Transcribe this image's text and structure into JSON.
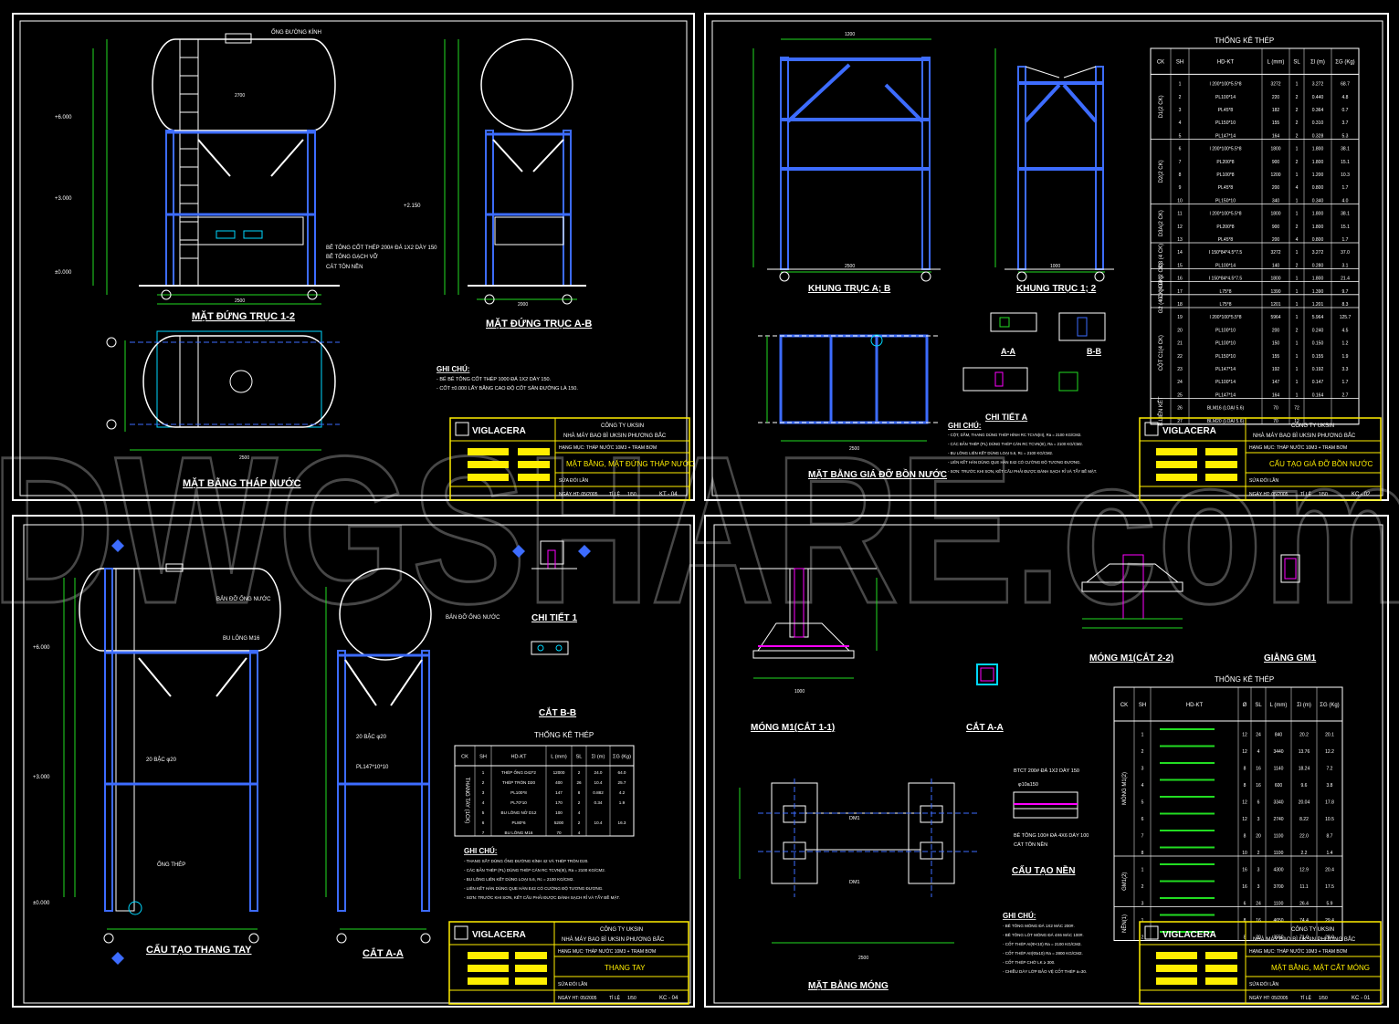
{
  "watermark": "DWGSHARE.com",
  "colors": {
    "struct": "#3d6cff",
    "dim": "#22dd22",
    "line": "#ffffff",
    "accent": "#ff00ff",
    "cyan": "#00d8ff",
    "yellow": "#ffee00"
  },
  "company": {
    "logo": "VIGLACERA",
    "name": "CÔNG TY UKSIN",
    "project": "NHÀ MÁY BAO BÌ UKSIN PHƯƠNG BẮC",
    "item": "HẠNG MỤC: THÁP NƯỚC 10M3 + TRẠM BƠM",
    "date": "NGÀY HT: 05/2005",
    "scale": "TỈ LỆ",
    "scale_val": "1/50",
    "draw": "THỰC",
    "rev": "SỬA ĐỔI LẦN",
    "shbv": "SH.B.V"
  },
  "sheet1": {
    "views": [
      "MẶT ĐỨNG TRỤC 1-2",
      "MẶT ĐỨNG TRỤC A-B",
      "MẶT BẰNG THÁP NƯỚC"
    ],
    "levels": [
      "+6.000",
      "+3.000",
      "+2.150",
      "±0.000"
    ],
    "notes_title": "GHI CHÚ:",
    "notes": [
      "- BỂ BÊ TÔNG CỐT THÉP 1000 ĐÁ 1X2 DÀY 150.",
      "- CỐT ±0.000 LẤY BẰNG CAO ĐỘ CỐT SÂN ĐƯỜNG LÀ 150."
    ],
    "labels": [
      "ỐNG ĐƯỜNG KÍNH",
      "BÊ TÔNG CỐT THÉP 200# ĐÁ 1X2 DÀY 150",
      "BÊ TÔNG GẠCH VỠ",
      "CÁT TÔN NỀN"
    ],
    "title_block": "MẶT BẰNG, MẶT ĐỨNG THÁP NƯỚC",
    "code": "KT - 04",
    "dims": [
      "2700",
      "2500",
      "900",
      "2000"
    ]
  },
  "sheet2": {
    "views": [
      "KHUNG TRỤC A; B",
      "KHUNG TRỤC 1; 2",
      "MẶT BẰNG GIÁ ĐỠ BỒN NƯỚC",
      "A-A",
      "B-B",
      "CHI TIẾT A"
    ],
    "table_title": "THỐNG KÊ THÉP",
    "table_headers": [
      "CK",
      "SH",
      "HD-KT",
      "L (mm)",
      "SL",
      "Σl (m)",
      "ΣG (Kg)"
    ],
    "groups": [
      "D1(2 CK)",
      "D2(2 CK)",
      "D3A(2 CK)",
      "D3 (4 CK)",
      "D4 (2 CK)",
      "G1 (4 CK)",
      "G2 (4 CK)",
      "CỘT C1(4 CK)",
      "B.LIÊN KẾT"
    ],
    "rows": [
      [
        "1",
        "I 200*100*5.5*8",
        "3272",
        "1",
        "3.272",
        "68.7"
      ],
      [
        "2",
        "PL100*14",
        "220",
        "2",
        "0.440",
        "4.8"
      ],
      [
        "3",
        "PL45*8",
        "182",
        "2",
        "0.364",
        "0.7"
      ],
      [
        "4",
        "PL150*10",
        "155",
        "2",
        "0.310",
        "3.7"
      ],
      [
        "5",
        "PL147*14",
        "164",
        "2",
        "0.328",
        "5.3"
      ],
      [
        "6",
        "I 200*100*5.5*8",
        "1800",
        "1",
        "1.800",
        "38.1"
      ],
      [
        "7",
        "PL200*8",
        "900",
        "2",
        "1.800",
        "15.1"
      ],
      [
        "8",
        "PL100*8",
        "1200",
        "1",
        "1.200",
        "10.3"
      ],
      [
        "9",
        "PL45*8",
        "200",
        "4",
        "0.800",
        "1.7"
      ],
      [
        "10",
        "PL150*10",
        "340",
        "1",
        "0.340",
        "4.0"
      ],
      [
        "11",
        "I 200*100*5.5*8",
        "1800",
        "1",
        "1.800",
        "38.1"
      ],
      [
        "12",
        "PL200*8",
        "900",
        "2",
        "1.800",
        "15.1"
      ],
      [
        "13",
        "PL45*8",
        "200",
        "4",
        "0.800",
        "1.7"
      ],
      [
        "14",
        "I 150*84*4.5*7.5",
        "3272",
        "1",
        "3.272",
        "37.0"
      ],
      [
        "15",
        "PL100*14",
        "140",
        "2",
        "0.280",
        "3.1"
      ],
      [
        "16",
        "I 150*84*4.5*7.5",
        "1800",
        "1",
        "1.800",
        "21.4"
      ],
      [
        "17",
        "L75*8",
        "1390",
        "1",
        "1.390",
        "9.7"
      ],
      [
        "18",
        "L75*8",
        "1201",
        "1",
        "1.201",
        "8.3"
      ],
      [
        "19",
        "I 200*100*5.5*8",
        "5964",
        "1",
        "5.964",
        "125.7"
      ],
      [
        "20",
        "PL100*10",
        "200",
        "2",
        "0.240",
        "4.5"
      ],
      [
        "21",
        "PL100*10",
        "150",
        "1",
        "0.150",
        "1.2"
      ],
      [
        "22",
        "PL150*10",
        "155",
        "1",
        "0.155",
        "1.9"
      ],
      [
        "23",
        "PL147*14",
        "192",
        "1",
        "0.192",
        "3.3"
      ],
      [
        "24",
        "PL100*14",
        "147",
        "1",
        "0.147",
        "1.7"
      ],
      [
        "25",
        "PL147*14",
        "164",
        "1",
        "0.164",
        "2.7"
      ],
      [
        "26",
        "BLM16 (LOẠI 5.6)",
        "70",
        "72",
        "",
        " "
      ],
      [
        "27",
        "BLM20 (LOẠI 5.6)",
        "70",
        "12",
        "",
        " "
      ]
    ],
    "notes_title": "GHI CHÚ:",
    "notes": [
      "- CỘT, DẦM, THANG DÙNG THÉP HÌNH RC TCVN(III), Ra = 2100 KG/CM2.",
      "- CÁC BẢN THÉP (PL) DÙNG THÉP CÁN RC TCVN(III), Ra = 2100 KG/CM2.",
      "- BU LÔNG LIÊN KẾT DÙNG LOẠI 5.6, Rc = 2100 KG/CM2.",
      "- LIÊN KẾT HÀN DÙNG QUE HÀN E42 CÓ CƯỜNG ĐỘ TƯƠNG ĐƯƠNG.",
      "- SƠN: TRƯỚC KHI SƠN, KẾT CẤU PHẢI ĐƯỢC ĐÁNH SẠCH RỈ VÀ TẨY BỀ MẶT."
    ],
    "title_block": "CẤU TẠO GIÁ ĐỠ BỒN NƯỚC",
    "code": "KC - 02",
    "dims": [
      "1200",
      "1000",
      "2500",
      "2000"
    ]
  },
  "sheet3": {
    "views": [
      "CẤU TẠO THANG TAY",
      "CẮT A-A",
      "CHI TIẾT 1",
      "CẮT B-B"
    ],
    "table_title": "THỐNG KÊ THÉP",
    "table_headers": [
      "CK",
      "SH",
      "HD-KT",
      "L (mm)",
      "SL",
      "Σl (m)",
      "ΣG (Kg)"
    ],
    "group": "THANG TAY (1CK)",
    "rows": [
      [
        "1",
        "THÉP ỐNG D42*2",
        "12000",
        "2",
        "24.0",
        "64.0"
      ],
      [
        "2",
        "THÉP TRÒN D20",
        "400",
        "26",
        "10.4",
        "25.7"
      ],
      [
        "3",
        "PL100*8",
        "147",
        "8",
        "0.882",
        "4.2"
      ],
      [
        "4",
        "PL70*10",
        "170",
        "2",
        "0.34",
        "1.9"
      ],
      [
        "5",
        "BU LÔNG NỞ D12",
        "100",
        "4",
        "",
        ""
      ],
      [
        "6",
        "PL80*6",
        "5200",
        "2",
        "10.4",
        "16.3"
      ],
      [
        "7",
        "BU LÔNG M16",
        "70",
        "4",
        "",
        ""
      ]
    ],
    "notes_title": "GHI CHÚ:",
    "notes": [
      "- THANG SẮT DÙNG ỐNG ĐƯỜNG KÍNH 42 VÀ THÉP TRÒN D20.",
      "- CÁC BẢN THÉP (PL) DÙNG THÉP CÁN RC TCVN(III), Ra = 2100 KG/CM2.",
      "- BU LÔNG LIÊN KẾT DÙNG LOẠI 5.6, Rc = 2100 KG/CM2.",
      "- LIÊN KẾT HÀN DÙNG QUE HÀN E42 CÓ CƯỜNG ĐỘ TƯƠNG ĐƯƠNG.",
      "- SƠN: TRƯỚC KHI SƠN, KẾT CẤU PHẢI ĐƯỢC ĐÁNH SẠCH RỈ VÀ TẨY BỀ MẶT."
    ],
    "labels": [
      "BẢN ĐỠ ỐNG NƯỚC",
      "PL80*6",
      "BU LÔNG M16",
      "20 BẬC φ20",
      "ỐNG THÉP",
      "TRÒN ĐẶC φ20",
      "PL147*10*10"
    ],
    "title_block": "THANG TAY",
    "code": "KC - 04",
    "levels": [
      "+6.000",
      "+3.000",
      "±0.000"
    ]
  },
  "sheet4": {
    "views": [
      "MÓNG M1(CẮT 1-1)",
      "CẮT A-A",
      "MÓNG M1(CẮT 2-2)",
      "GIẰNG GM1",
      "MẶT BẰNG MÓNG",
      "CẤU TẠO NỀN"
    ],
    "table_title": "THỐNG KÊ THÉP",
    "table_headers": [
      "CK",
      "SH",
      "HD-KT",
      "Ø",
      "SL",
      "L (mm)",
      "Σl (m)",
      "ΣG (Kg)"
    ],
    "groups": [
      "MÓNG M1(2)",
      "GM1(2)",
      "NỀN(1)"
    ],
    "rows": [
      [
        "1",
        "12",
        "24",
        "840",
        "20.2",
        "20.1"
      ],
      [
        "2",
        "12",
        "4",
        "3440",
        "13.76",
        "12.2"
      ],
      [
        "3",
        "8",
        "16",
        "1140",
        "18.24",
        "7.2"
      ],
      [
        "4",
        "8",
        "16",
        "600",
        "9.6",
        "3.8"
      ],
      [
        "5",
        "12",
        "6",
        "3340",
        "20.04",
        "17.8"
      ],
      [
        "6",
        "12",
        "3",
        "2740",
        "8.22",
        "10.5"
      ],
      [
        "7",
        "8",
        "20",
        "1100",
        "22.0",
        "8.7"
      ],
      [
        "8",
        "10",
        "2",
        "1100",
        "2.2",
        "1.4"
      ],
      [
        "1",
        "16",
        "3",
        "4300",
        "12.9",
        "20.4"
      ],
      [
        "2",
        "16",
        "3",
        "3700",
        "11.1",
        "17.5"
      ],
      [
        "3",
        "6",
        "24",
        "1100",
        "26.4",
        "5.9"
      ],
      [
        "1",
        "8",
        "16",
        "4650",
        "74.4",
        "29.4"
      ],
      [
        "2",
        "8",
        "20",
        "3550",
        "71.0",
        "28.0"
      ]
    ],
    "notes_title": "GHI CHÚ:",
    "notes": [
      "- BÊ TÔNG MÓNG ĐÁ 1X2 MÁC 200#.",
      "- BÊ TÔNG LÓT MÓNG ĐÁ 4X6 MÁC 100#.",
      "- CỐT THÉP AI(Φ<10) Ra = 2100 KG/CM2.",
      "- CỐT THÉP AII(Φ≥10) Ra = 2800 KG/CM2.",
      "- CỐT THÉP CHỜ LK ≥ 300.",
      "- CHIỀU DÀY LỚP BẢO VỆ CỐT THÉP a=30."
    ],
    "labels": [
      "BTCT 200# ĐÁ 1X2 DÀY 150",
      "φ10a150",
      "BÊ TÔNG 100# ĐÁ 4X6 DÀY 100",
      "CÁT TÔN NỀN",
      "DM1"
    ],
    "title_block": "MẶT BẰNG, MẶT CẮT MÓNG",
    "code": "KC - 01",
    "dims": [
      "2500",
      "1000",
      "3500",
      "275"
    ]
  }
}
